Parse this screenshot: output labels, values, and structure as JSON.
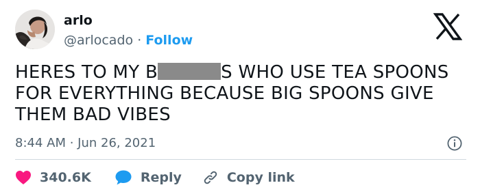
{
  "author": {
    "name": "arlo",
    "handle": "@arlocado",
    "separator": "·",
    "follow_label": "Follow"
  },
  "tweet": {
    "text_before_censor": "HERES TO MY B",
    "text_after_censor": "S WHO USE TEA SPOONS FOR EVERYTHING BECAUSE BIG SPOONS GIVE THEM BAD VIBES",
    "timestamp": "8:44 AM · Jun 26, 2021"
  },
  "actions": {
    "likes_count": "340.6K",
    "reply_label": "Reply",
    "copy_link_label": "Copy link"
  },
  "icons": {
    "brand": "x-logo-icon",
    "info": "info-icon",
    "like": "heart-icon",
    "reply": "speech-bubble-icon",
    "copy": "link-icon"
  },
  "colors": {
    "text": "#0f1419",
    "muted": "#536471",
    "accent": "#1d9bf0",
    "like": "#f91880",
    "divider": "#cfd9de",
    "censor": "#8a8a8a"
  }
}
